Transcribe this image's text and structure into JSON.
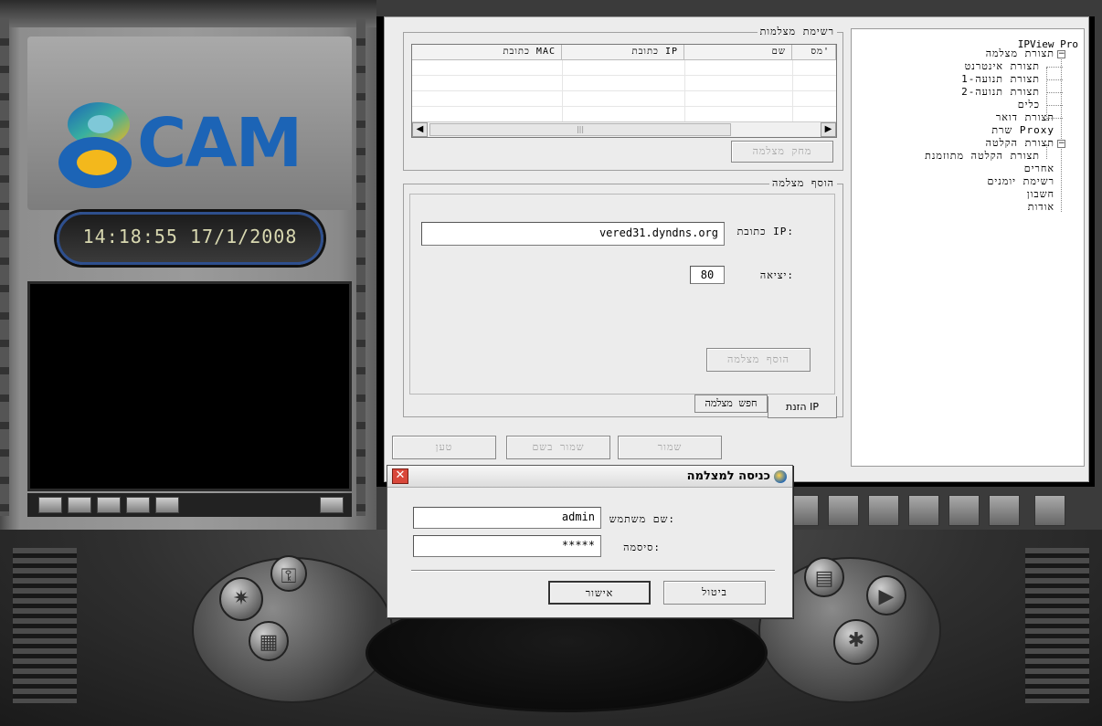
{
  "clock": "14:18:55 17/1/2008",
  "logo": {
    "text": "CAM"
  },
  "tree": {
    "root": "IPView Pro",
    "items": [
      "תצורת מצלמה",
      "תצורת אינטרנט",
      "תצורת תנועה-1",
      "תצורת תנועה-2",
      "כלים",
      "תצורת דואר",
      "שרת Proxy",
      "תצורת הקלטה",
      "תצורת הקלטה מתוזמנת",
      "אחרים",
      "רשימת יומנים",
      "חשבון",
      "אודות"
    ]
  },
  "camera_list": {
    "title": "רשימת מצלמות",
    "columns": [
      "מס'",
      "שם",
      "כתובת IP",
      "כתובת MAC"
    ],
    "delete_button": "מחק מצלמה"
  },
  "add_camera": {
    "title": "הוסף מצלמה",
    "ip_label": "כתובת IP:",
    "ip_value": "vered31.dyndns.org",
    "port_label": "יציאה:",
    "port_value": "80",
    "add_button": "הוסף מצלמה",
    "tabs": [
      "הזנת IP",
      "חפש מצלמה"
    ]
  },
  "bottom_buttons": {
    "save": "שמור",
    "save_as": "שמור בשם",
    "load": "טען"
  },
  "dialog": {
    "title": "כניסה למצלמה",
    "username_label": "שם משתמש:",
    "username_value": "admin",
    "password_label": "סיסמה:",
    "password_value": "*****",
    "ok_button": "אישור",
    "cancel_button": "ביטול"
  },
  "colors": {
    "logo_blue": "#1c64b6",
    "clock_ring": "#2e4f8d",
    "close_red": "#d9473a"
  }
}
